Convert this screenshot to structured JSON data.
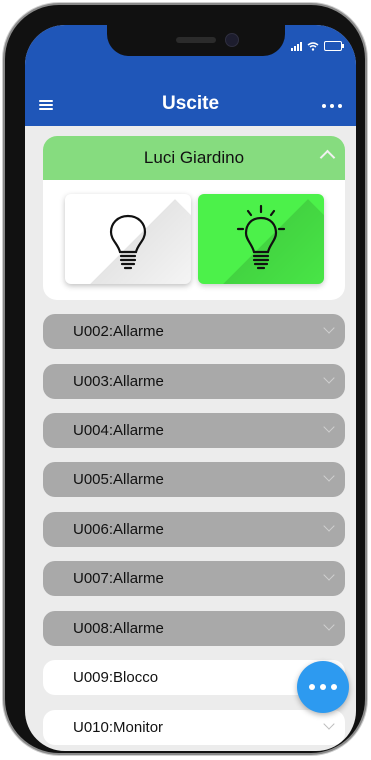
{
  "header": {
    "title": "Uscite"
  },
  "light_card": {
    "title": "Luci Giardino",
    "off_color": "#ffffff",
    "on_color": "#4cf14a",
    "head_color": "#86dc7f"
  },
  "outputs": [
    {
      "label": "U002:Allarme",
      "style": "gray"
    },
    {
      "label": "U003:Allarme",
      "style": "gray"
    },
    {
      "label": "U004:Allarme",
      "style": "gray"
    },
    {
      "label": "U005:Allarme",
      "style": "gray"
    },
    {
      "label": "U006:Allarme",
      "style": "gray"
    },
    {
      "label": "U007:Allarme",
      "style": "gray"
    },
    {
      "label": "U008:Allarme",
      "style": "gray"
    },
    {
      "label": "U009:Blocco",
      "style": "white"
    },
    {
      "label": "U010:Monitor",
      "style": "white"
    }
  ],
  "colors": {
    "header": "#1f56b8",
    "fab": "#2d9af0"
  },
  "icons": [
    "menu-icon",
    "more-icon",
    "bulb-off-icon",
    "bulb-on-icon",
    "chevron-up-icon",
    "chevron-down-icon",
    "fab-dots-icon"
  ]
}
